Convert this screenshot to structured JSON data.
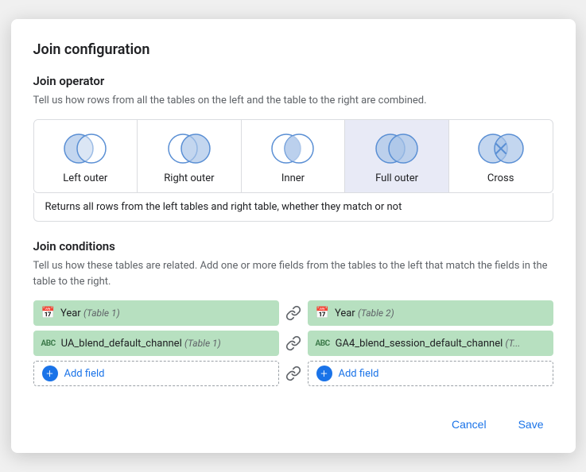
{
  "dialog": {
    "title": "Join configuration",
    "operator_section": {
      "title": "Join operator",
      "description": "Tell us how rows from all the tables on the left and the table to the right are combined.",
      "options": [
        {
          "id": "left_outer",
          "label": "Left outer",
          "selected": false
        },
        {
          "id": "right_outer",
          "label": "Right outer",
          "selected": false
        },
        {
          "id": "inner",
          "label": "Inner",
          "selected": false
        },
        {
          "id": "full_outer",
          "label": "Full outer",
          "selected": true
        },
        {
          "id": "cross",
          "label": "Cross",
          "selected": false
        }
      ],
      "selected_description": "Returns all rows from the left tables and right table, whether they match or not"
    },
    "conditions_section": {
      "title": "Join conditions",
      "description": "Tell us how these tables are related. Add one or more fields from the tables to the left that match the fields in the table to the right.",
      "left_fields": [
        {
          "type": "calendar",
          "text": "Year",
          "table": "(Table 1)"
        },
        {
          "type": "abc",
          "text": "UA_blend_default_channel",
          "table": "(Table 1)"
        }
      ],
      "right_fields": [
        {
          "type": "calendar",
          "text": "Year",
          "table": "(Table 2)"
        },
        {
          "type": "abc",
          "text": "GA4_blend_session_default_channel",
          "table": "(T..."
        }
      ],
      "add_field_label": "Add field"
    },
    "footer": {
      "cancel_label": "Cancel",
      "save_label": "Save"
    }
  }
}
